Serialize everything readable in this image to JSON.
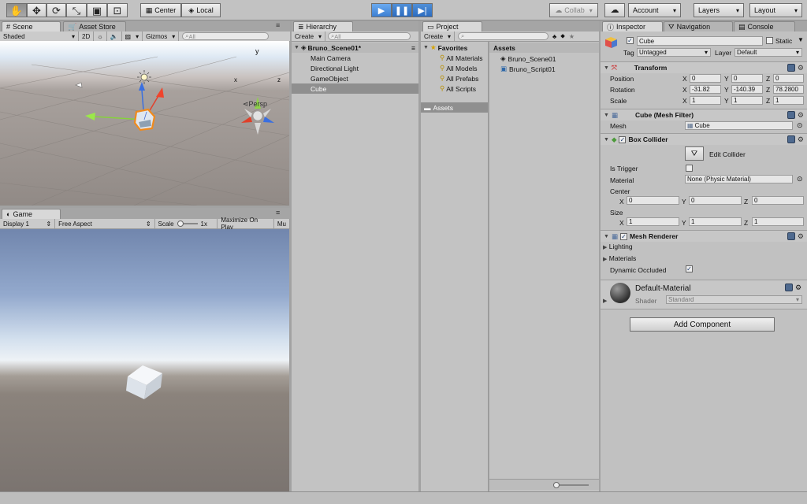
{
  "toolbar": {
    "pivot_label": "Center",
    "space_label": "Local",
    "collab_label": "Collab",
    "account_label": "Account",
    "layers_label": "Layers",
    "layout_label": "Layout"
  },
  "scene": {
    "tab_label": "Scene",
    "asset_store_tab": "Asset Store",
    "shading_mode": "Shaded",
    "mode_2d": "2D",
    "gizmos_label": "Gizmos",
    "search_placeholder": "All",
    "persp_label": "Persp",
    "axis_x": "x",
    "axis_y": "y",
    "axis_z": "z"
  },
  "game": {
    "tab_label": "Game",
    "display": "Display 1",
    "aspect": "Free Aspect",
    "scale_label": "Scale",
    "scale_value": "1x",
    "maximize_label": "Maximize On Play",
    "mute_label": "Mu"
  },
  "hierarchy": {
    "tab_label": "Hierarchy",
    "create_label": "Create",
    "search_placeholder": "All",
    "scene_name": "Bruno_Scene01*",
    "items": [
      "Main Camera",
      "Directional Light",
      "GameObject",
      "Cube"
    ],
    "selected": "Cube"
  },
  "project": {
    "tab_label": "Project",
    "create_label": "Create",
    "favorites_label": "Favorites",
    "favorites": [
      "All Materials",
      "All Models",
      "All Prefabs",
      "All Scripts"
    ],
    "assets_folder": "Assets",
    "assets_header": "Assets",
    "assets": [
      "Bruno_Scene01",
      "Bruno_Script01"
    ]
  },
  "inspector": {
    "tab_label": "Inspector",
    "navigation_tab": "Navigation",
    "console_tab": "Console",
    "object_name": "Cube",
    "static_label": "Static",
    "tag_label": "Tag",
    "tag_value": "Untagged",
    "layer_label": "Layer",
    "layer_value": "Default",
    "transform": {
      "title": "Transform",
      "position_label": "Position",
      "rotation_label": "Rotation",
      "scale_label": "Scale",
      "position": {
        "x": "0",
        "y": "0",
        "z": "0"
      },
      "rotation": {
        "x": "-31.82",
        "y": "-140.39",
        "z": "78.2800"
      },
      "scale": {
        "x": "1",
        "y": "1",
        "z": "1"
      }
    },
    "mesh_filter": {
      "title": "Cube (Mesh Filter)",
      "mesh_label": "Mesh",
      "mesh_value": "Cube"
    },
    "box_collider": {
      "title": "Box Collider",
      "edit_label": "Edit Collider",
      "is_trigger_label": "Is Trigger",
      "material_label": "Material",
      "material_value": "None (Physic Material)",
      "center_label": "Center",
      "size_label": "Size",
      "center": {
        "x": "0",
        "y": "0",
        "z": "0"
      },
      "size": {
        "x": "1",
        "y": "1",
        "z": "1"
      }
    },
    "mesh_renderer": {
      "title": "Mesh Renderer",
      "lighting_label": "Lighting",
      "materials_label": "Materials",
      "dynamic_occluded_label": "Dynamic Occluded"
    },
    "material": {
      "name": "Default-Material",
      "shader_label": "Shader",
      "shader_value": "Standard"
    },
    "add_component_label": "Add Component",
    "axis_x": "X",
    "axis_y": "Y",
    "axis_z": "Z"
  },
  "colors": {
    "play_blue": "#3d7fd2",
    "selection_orange": "#f08a1c",
    "ui_gray": "#c2c2c2"
  }
}
